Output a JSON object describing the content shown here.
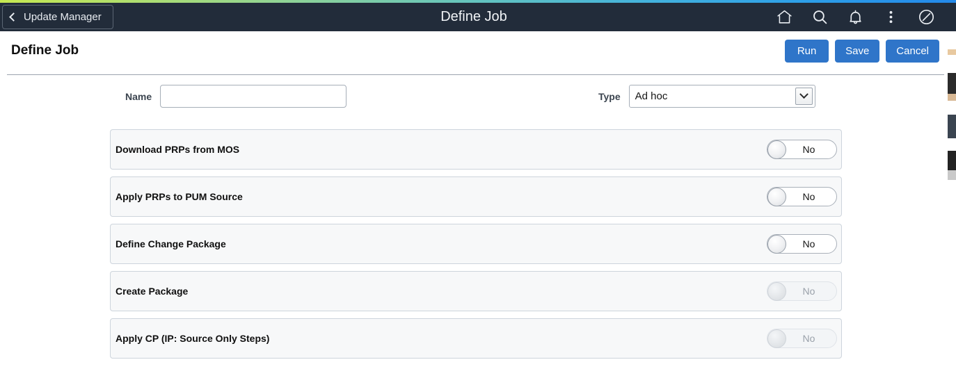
{
  "header": {
    "back_label": "Update Manager",
    "back_icon": "chevron-left-icon",
    "title": "Define Job",
    "icons": [
      {
        "name": "home-icon",
        "label": "Home"
      },
      {
        "name": "search-icon",
        "label": "Search"
      },
      {
        "name": "bell-icon",
        "label": "Notifications"
      },
      {
        "name": "vertical-dots-icon",
        "label": "Actions"
      },
      {
        "name": "circle-slash-icon",
        "label": "NavBar"
      }
    ],
    "gradient_start": "#c6e852",
    "gradient_end": "#2389ea",
    "background": "#222c3a"
  },
  "page": {
    "title": "Define Job",
    "buttons": {
      "run": "Run",
      "save": "Save",
      "cancel": "Cancel"
    },
    "button_color": "#2f75c9"
  },
  "form": {
    "name": {
      "label": "Name",
      "value": "",
      "placeholder": ""
    },
    "type": {
      "label": "Type",
      "value": "Ad hoc",
      "arrow_icon": "chevron-down-icon",
      "options": [
        "Ad hoc"
      ]
    }
  },
  "steps": [
    {
      "label": "Download PRPs from MOS",
      "toggle": "No",
      "enabled": true
    },
    {
      "label": "Apply PRPs to PUM Source",
      "toggle": "No",
      "enabled": true
    },
    {
      "label": "Define Change Package",
      "toggle": "No",
      "enabled": true
    },
    {
      "label": "Create Package",
      "toggle": "No",
      "enabled": false
    },
    {
      "label": "Apply CP (IP: Source Only Steps)",
      "toggle": "No",
      "enabled": false
    }
  ]
}
